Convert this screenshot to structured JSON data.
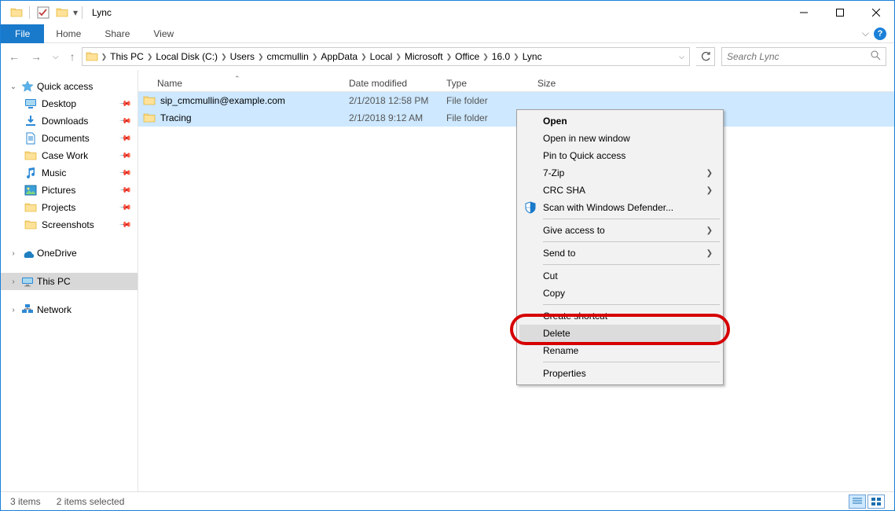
{
  "window": {
    "title": "Lync"
  },
  "ribbon": {
    "file": "File",
    "tabs": [
      "Home",
      "Share",
      "View"
    ]
  },
  "breadcrumb": [
    "This PC",
    "Local Disk (C:)",
    "Users",
    "cmcmullin",
    "AppData",
    "Local",
    "Microsoft",
    "Office",
    "16.0",
    "Lync"
  ],
  "search": {
    "placeholder": "Search Lync"
  },
  "nav": {
    "quick_access": {
      "label": "Quick access",
      "items": [
        {
          "label": "Desktop",
          "icon": "desktop"
        },
        {
          "label": "Downloads",
          "icon": "downloads"
        },
        {
          "label": "Documents",
          "icon": "documents"
        },
        {
          "label": "Case Work",
          "icon": "folder"
        },
        {
          "label": "Music",
          "icon": "music"
        },
        {
          "label": "Pictures",
          "icon": "pictures"
        },
        {
          "label": "Projects",
          "icon": "folder"
        },
        {
          "label": "Screenshots",
          "icon": "folder"
        }
      ]
    },
    "onedrive": {
      "label": "OneDrive"
    },
    "thispc": {
      "label": "This PC"
    },
    "network": {
      "label": "Network"
    }
  },
  "columns": {
    "name": "Name",
    "date": "Date modified",
    "type": "Type",
    "size": "Size"
  },
  "rows": [
    {
      "name": "sip_cmcmullin@example.com",
      "date": "2/1/2018 12:58 PM",
      "type": "File folder",
      "size": ""
    },
    {
      "name": "Tracing",
      "date": "2/1/2018 9:12 AM",
      "type": "File folder",
      "size": ""
    }
  ],
  "context_menu": {
    "open": "Open",
    "open_new_window": "Open in new window",
    "pin_quick": "Pin to Quick access",
    "sevenzip": "7-Zip",
    "crc_sha": "CRC SHA",
    "defender": "Scan with Windows Defender...",
    "give_access": "Give access to",
    "send_to": "Send to",
    "cut": "Cut",
    "copy": "Copy",
    "create_shortcut": "Create shortcut",
    "delete": "Delete",
    "rename": "Rename",
    "properties": "Properties"
  },
  "status": {
    "items": "3 items",
    "selected": "2 items selected"
  }
}
